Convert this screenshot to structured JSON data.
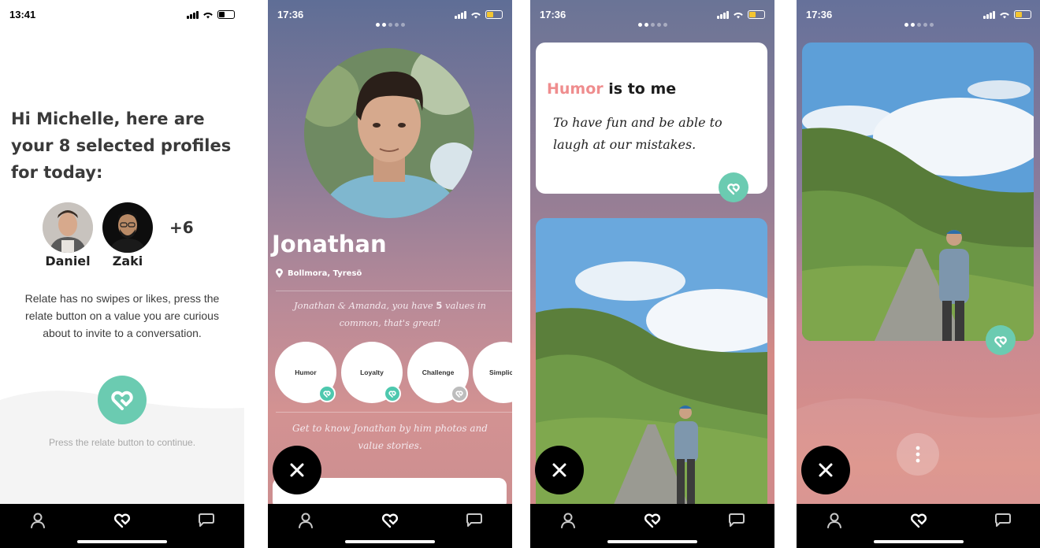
{
  "screens": [
    {
      "time": "13:41",
      "greeting": "Hi Michelle, here are your 8 selected profiles for today:",
      "profiles": [
        "Daniel",
        "Zaki"
      ],
      "more_count": "+6",
      "info": "Relate has no swipes or likes, press the relate button on a value you are curious about to invite to a conversation.",
      "press_hint": "Press the relate button to continue."
    },
    {
      "time": "17:36",
      "name": "Jonathan",
      "location": "Bollmora, Tyresö",
      "shared_before": "Jonathan & Amanda, you have ",
      "shared_count": "5",
      "shared_after": " values in common, that's great!",
      "values": [
        {
          "label": "Humor",
          "state": "active"
        },
        {
          "label": "Loyalty",
          "state": "active"
        },
        {
          "label": "Challenge",
          "state": "inactive"
        },
        {
          "label": "Simplic",
          "state": "none"
        }
      ],
      "get_to_know": "Get to know Jonathan by him photos and value stories."
    },
    {
      "time": "17:36",
      "value_highlight": "Humor",
      "value_title_rest": " is to me",
      "value_story": "To have fun and be able to laugh at our mistakes."
    },
    {
      "time": "17:36"
    }
  ],
  "tab_icons": [
    "person-icon",
    "relate-heart-icon",
    "chat-icon"
  ],
  "colors": {
    "accent_teal": "#6bcbb1",
    "highlight_pink": "#ef8d8e",
    "tabbar": "#000000"
  }
}
